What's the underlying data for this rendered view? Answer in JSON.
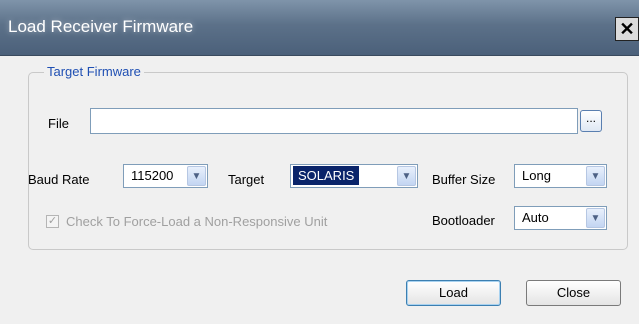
{
  "window": {
    "title": "Load Receiver Firmware",
    "close_glyph": "✕"
  },
  "group": {
    "legend": "Target Firmware"
  },
  "file": {
    "label": "File",
    "value": "",
    "browse_label": "..."
  },
  "baud_rate": {
    "label": "Baud Rate",
    "value": "115200"
  },
  "target": {
    "label": "Target",
    "value": "SOLARIS"
  },
  "buffer_size": {
    "label": "Buffer Size",
    "value": "Long"
  },
  "bootloader": {
    "label": "Bootloader",
    "value": "Auto"
  },
  "force_load": {
    "label": "Check To Force-Load a Non-Responsive Unit",
    "checked": true,
    "check_glyph": "✓"
  },
  "buttons": {
    "load": "Load",
    "close": "Close"
  },
  "dropdown_glyph": "▼"
}
